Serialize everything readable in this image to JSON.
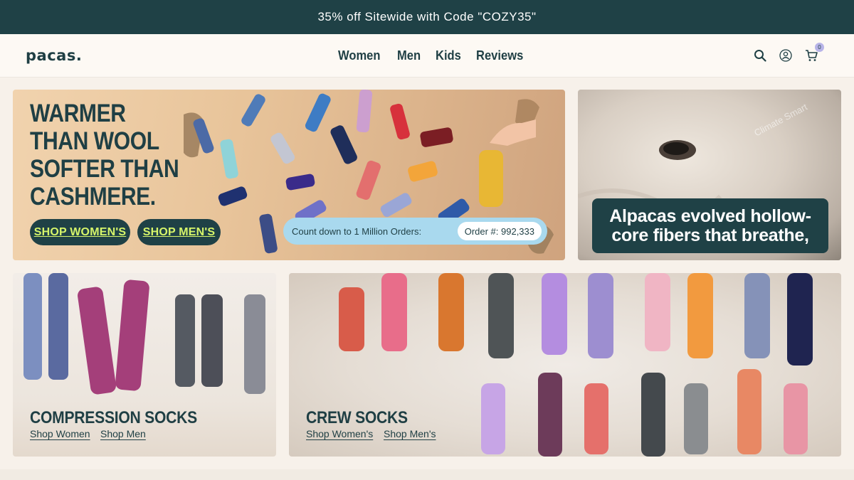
{
  "promo": {
    "text": "35% off Sitewide with Code \"COZY35\""
  },
  "header": {
    "logo": "pacas.",
    "nav": [
      "Women",
      "Men",
      "Kids",
      "Reviews"
    ],
    "cart_count": "0"
  },
  "hero": {
    "title": "WARMER THAN WOOL SOFTER THAN CASHMERE.",
    "shop_women": "SHOP WOMEN'S",
    "shop_men": "SHOP MEN'S",
    "countdown_label": "Count down to 1 Million Orders:",
    "order_count": "Order #: 992,333"
  },
  "alpaca": {
    "caption": "Alpacas evolved hollow-core fibers that breathe,",
    "watermark": "Climate Smart"
  },
  "compression": {
    "title": "COMPRESSION SOCKS",
    "link_women": "Shop Women",
    "link_men": "Shop Men"
  },
  "crew": {
    "title": "CREW SOCKS",
    "link_women": "Shop Women's",
    "link_men": "Shop Men's"
  },
  "colors": {
    "brand_dark": "#1f4146",
    "accent_lime": "#d6f56a",
    "countdown_blue": "#a9d9ee"
  },
  "icons": [
    "search-icon",
    "account-icon",
    "cart-icon"
  ]
}
